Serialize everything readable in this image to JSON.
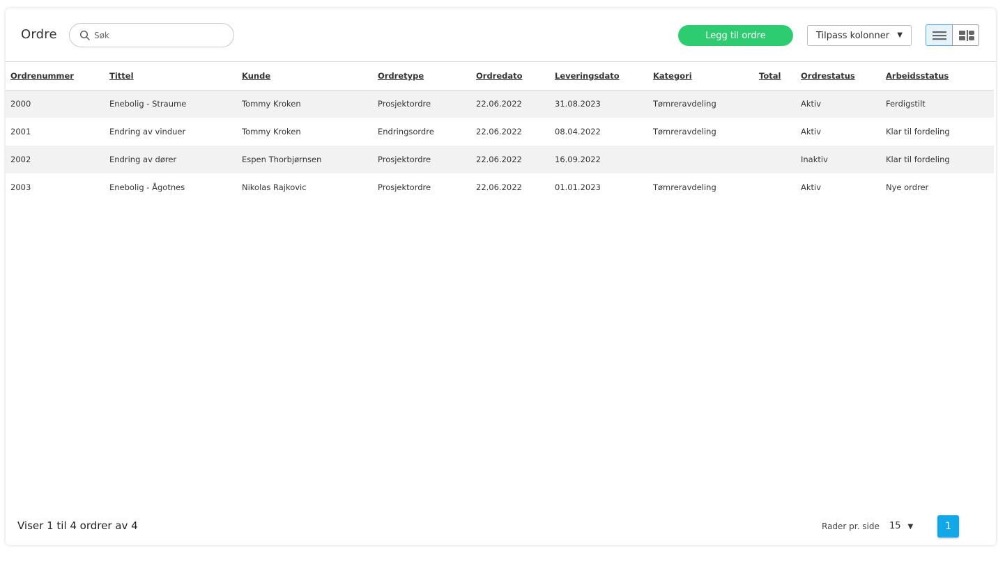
{
  "header": {
    "title": "Ordre",
    "search_placeholder": "Søk",
    "add_button": "Legg til ordre",
    "columns_select": "Tilpass kolonner"
  },
  "columns": [
    "Ordrenummer",
    "Tittel",
    "Kunde",
    "Ordretype",
    "Ordredato",
    "Leveringsdato",
    "Kategori",
    "Total",
    "Ordrestatus",
    "Arbeidsstatus"
  ],
  "rows": [
    {
      "nr": "2000",
      "tittel": "Enebolig - Straume",
      "kunde": "Tommy Kroken",
      "type": "Prosjektordre",
      "ordredato": "22.06.2022",
      "leveringsdato": "31.08.2023",
      "kategori": "Tømreravdeling",
      "total": "",
      "ordrestatus": "Aktiv",
      "arbeidsstatus": "Ferdigstilt"
    },
    {
      "nr": "2001",
      "tittel": "Endring av vinduer",
      "kunde": "Tommy Kroken",
      "type": "Endringsordre",
      "ordredato": "22.06.2022",
      "leveringsdato": "08.04.2022",
      "kategori": "Tømreravdeling",
      "total": "",
      "ordrestatus": "Aktiv",
      "arbeidsstatus": "Klar til fordeling"
    },
    {
      "nr": "2002",
      "tittel": "Endring av dører",
      "kunde": "Espen Thorbjørnsen",
      "type": "Prosjektordre",
      "ordredato": "22.06.2022",
      "leveringsdato": "16.09.2022",
      "kategori": "",
      "total": "",
      "ordrestatus": "Inaktiv",
      "arbeidsstatus": "Klar til fordeling"
    },
    {
      "nr": "2003",
      "tittel": "Enebolig - Ågotnes",
      "kunde": "Nikolas Rajkovic",
      "type": "Prosjektordre",
      "ordredato": "22.06.2022",
      "leveringsdato": "01.01.2023",
      "kategori": "Tømreravdeling",
      "total": "",
      "ordrestatus": "Aktiv",
      "arbeidsstatus": "Nye ordrer"
    }
  ],
  "footer": {
    "summary": "Viser 1 til 4 ordrer av 4",
    "rows_per_page_label": "Rader pr. side",
    "rows_per_page_value": "15",
    "current_page": "1"
  },
  "colors": {
    "accent_green": "#2ecc71",
    "active_status": "#1e9fd8",
    "page_button": "#12a8e8"
  }
}
